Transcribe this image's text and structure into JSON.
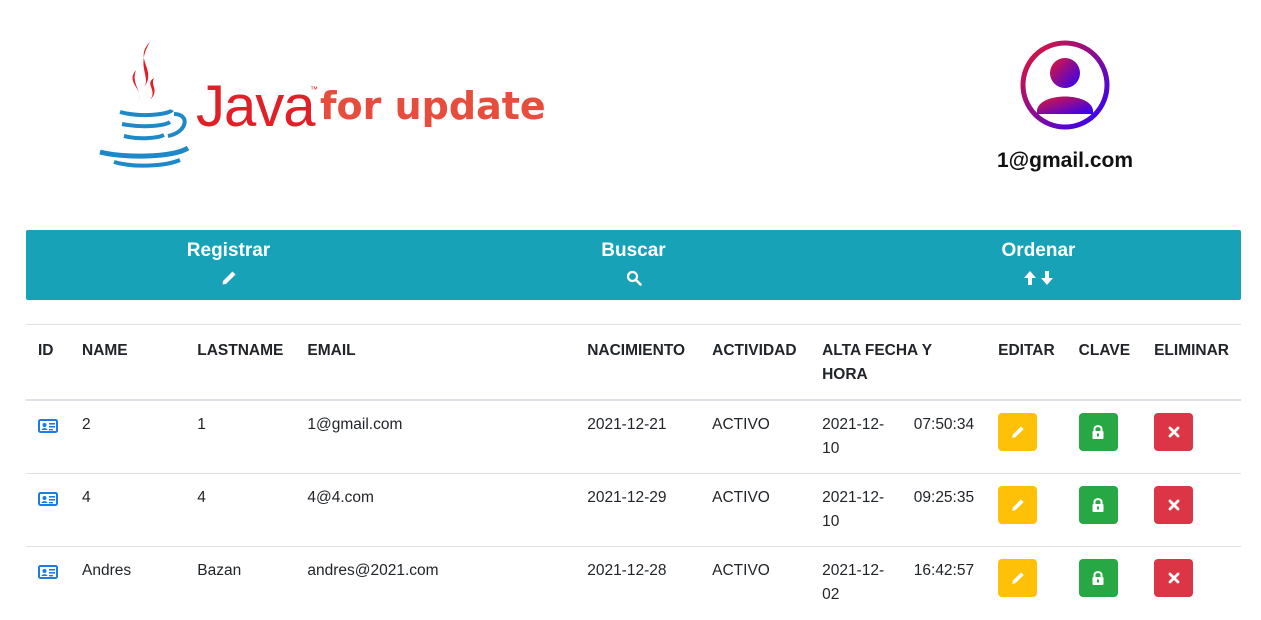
{
  "header": {
    "logo_word": "Java",
    "logo_tm": "™",
    "logo_suffix": "for update",
    "user_email": "1@gmail.com"
  },
  "nav": [
    {
      "label": "Registrar",
      "icon": "pencil-icon"
    },
    {
      "label": "Buscar",
      "icon": "search-icon"
    },
    {
      "label": "Ordenar",
      "icon": "sort-arrows-icon"
    }
  ],
  "table": {
    "headers": [
      "ID",
      "NAME",
      "LASTNAME",
      "EMAIL",
      "NACIMIENTO",
      "ACTIVIDAD",
      "ALTA FECHA Y HORA",
      "EDITAR",
      "CLAVE",
      "ELIMINAR"
    ],
    "rows": [
      {
        "name": "2",
        "lastname": "1",
        "email": "1@gmail.com",
        "nacimiento": "2021-12-21",
        "actividad": "ACTIVO",
        "alta_fecha": "2021-12-10",
        "alta_hora": "07:50:34"
      },
      {
        "name": "4",
        "lastname": "4",
        "email": "4@4.com",
        "nacimiento": "2021-12-29",
        "actividad": "ACTIVO",
        "alta_fecha": "2021-12-10",
        "alta_hora": "09:25:35"
      },
      {
        "name": "Andres",
        "lastname": "Bazan",
        "email": "andres@2021.com",
        "nacimiento": "2021-12-28",
        "actividad": "ACTIVO",
        "alta_fecha": "2021-12-02",
        "alta_hora": "16:42:57"
      }
    ]
  },
  "colors": {
    "nav_bg": "#17a2b8",
    "edit": "#ffc107",
    "key": "#28a745",
    "delete": "#dc3545",
    "logo_red": "#e74c3c",
    "id_icon": "#1e7be6"
  }
}
